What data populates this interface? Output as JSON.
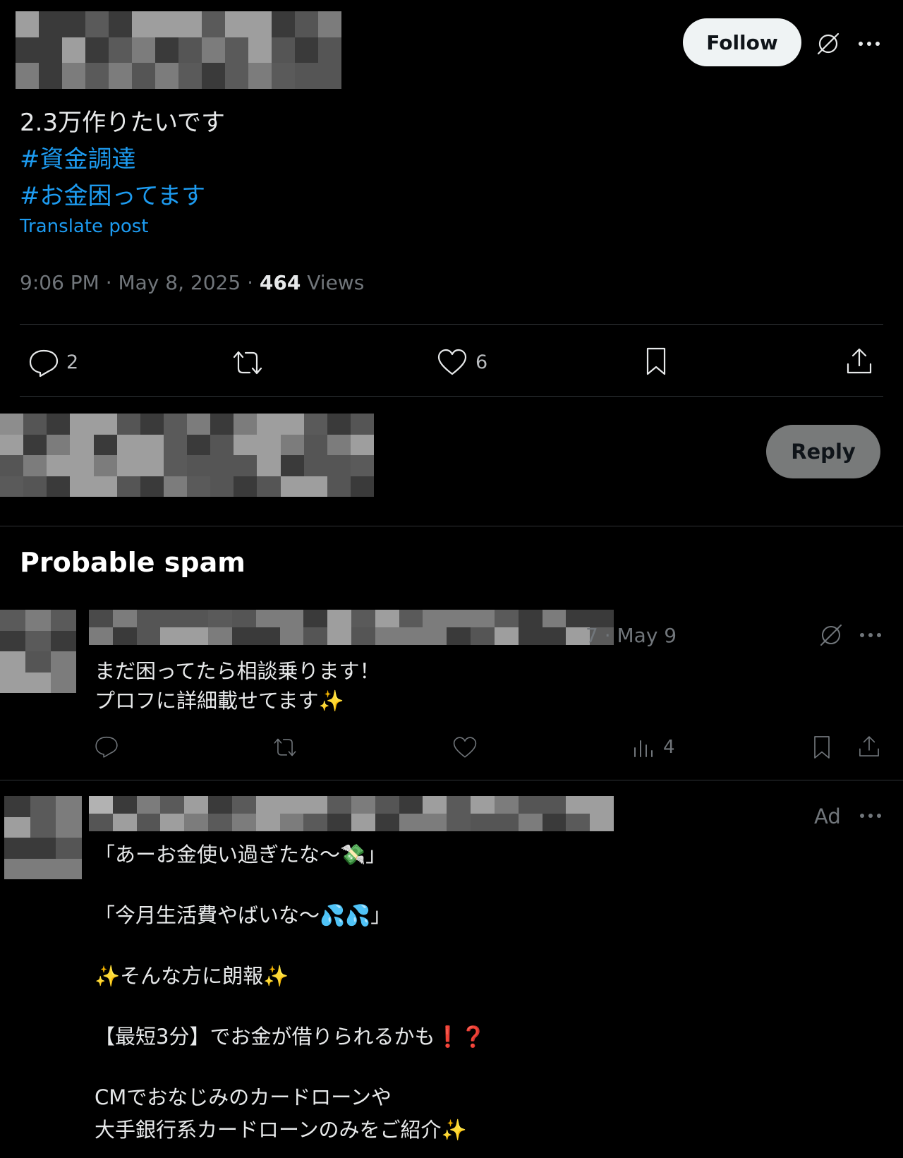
{
  "tweet": {
    "follow_label": "Follow",
    "text_line": "2.3万作りたいです",
    "hashtags": [
      "#資金調達",
      "#お金困ってます"
    ],
    "translate_label": "Translate post",
    "time": "9:06 PM · May 8, 2025 · ",
    "views_count": "464",
    "views_label": " Views",
    "actions": {
      "replies": "2",
      "likes": "6"
    }
  },
  "reply_box": {
    "reply_label": "Reply"
  },
  "spam_section": {
    "heading": "Probable spam",
    "reply": {
      "date_fragment": "7 · May 9",
      "lines": [
        "まだ困ってたら相談乗ります！",
        "プロフに詳細載せてます✨"
      ],
      "views": "4"
    }
  },
  "ad": {
    "ad_label": "Ad",
    "lines": [
      "「あーお金使い過ぎたな〜💸」",
      "「今月生活費やばいな〜💦💦」",
      "✨そんな方に朗報✨",
      "【最短3分】でお金が借りられるかも❗❓",
      "CMでおなじみのカードローンや",
      "大手銀行系カードローンのみをご紹介✨"
    ]
  },
  "icons": [
    "grok-icon",
    "more-icon",
    "reply-icon",
    "repost-icon",
    "like-icon",
    "bookmark-icon",
    "share-icon",
    "views-icon"
  ],
  "colors": {
    "background": "#000000",
    "link": "#1d9bf0",
    "muted": "#71767b",
    "text": "#e7e9ea",
    "divider": "#2f3336"
  }
}
